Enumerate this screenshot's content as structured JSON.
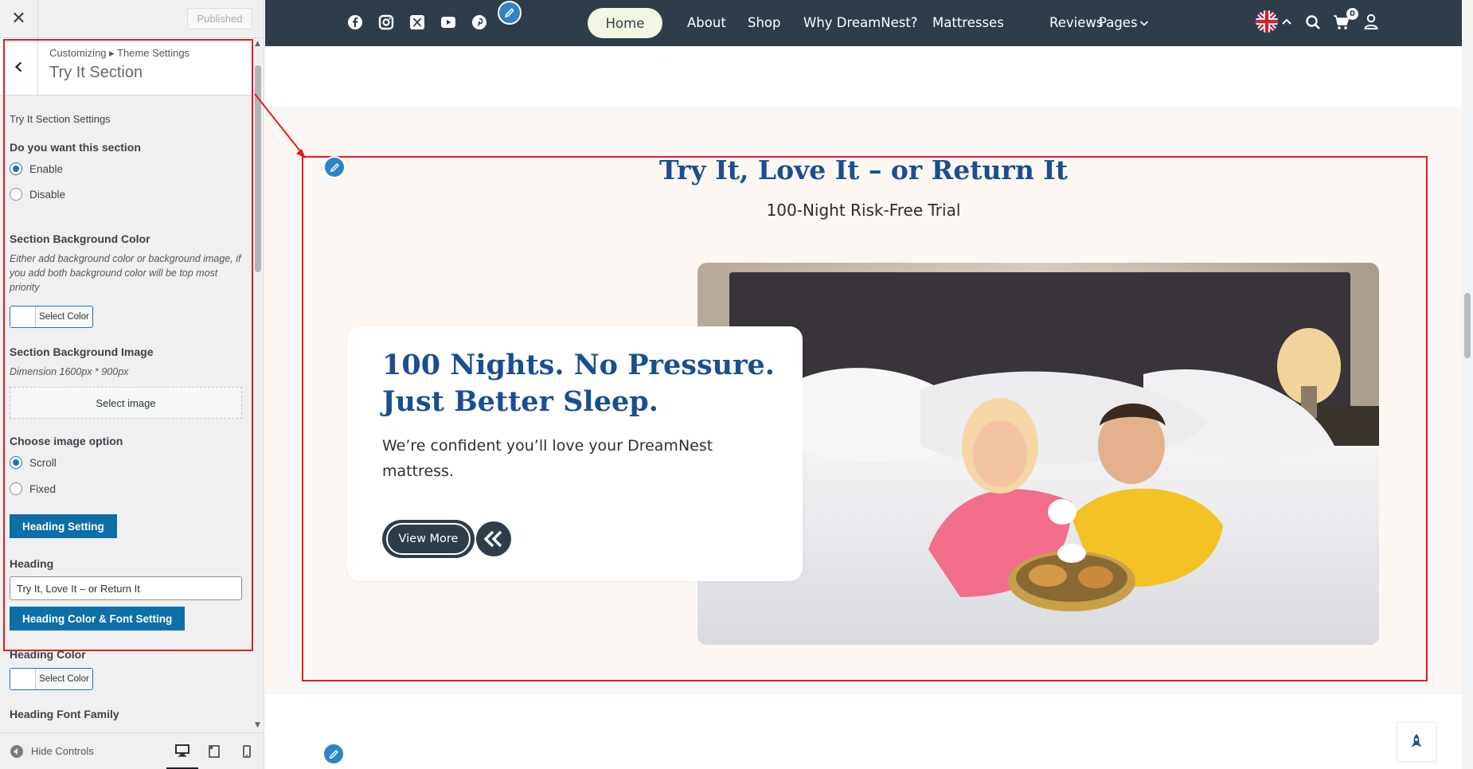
{
  "customizer": {
    "close_icon": "close-icon",
    "published_label": "Published",
    "breadcrumb": "Customizing ▸ Theme Settings",
    "section_title": "Try It Section",
    "settings_heading": "Try It Section Settings",
    "enable_label": "Do you want this section",
    "enable_options": [
      "Enable",
      "Disable"
    ],
    "enable_selected": "Enable",
    "bg_color_label": "Section Background Color",
    "bg_color_desc": "Either add background color or background image, if you add both background color will be top most priority",
    "select_color_label": "Select Color",
    "bg_image_label": "Section Background Image",
    "bg_image_desc": "Dimension 1600px * 900px",
    "select_image_label": "Select image",
    "image_option_label": "Choose image option",
    "image_options": [
      "Scroll",
      "Fixed"
    ],
    "image_option_selected": "Scroll",
    "heading_setting_btn": "Heading Setting",
    "heading_label": "Heading",
    "heading_value": "Try It, Love It – or Return It",
    "heading_font_btn": "Heading Color & Font Setting",
    "heading_color_label": "Heading Color",
    "heading_font_family_label": "Heading Font Family",
    "hide_controls_label": "Hide Controls"
  },
  "preview": {
    "nav": {
      "items": [
        "Home",
        "About",
        "Shop",
        "Why DreamNest?",
        "Mattresses",
        "Reviews",
        "Pages"
      ],
      "active": "Home",
      "cart_count": "0",
      "social_icons": [
        "facebook-icon",
        "instagram-icon",
        "x-icon",
        "youtube-icon",
        "pinterest-icon"
      ]
    },
    "try_section": {
      "heading": "Try It, Love It – or Return It",
      "subheading": "100-Night Risk-Free Trial",
      "card_title": "100 Nights. No Pressure. Just Better Sleep.",
      "card_text": "We’re confident you’ll love your DreamNest mattress.",
      "button_label": "View More"
    }
  },
  "colors": {
    "nav_bg": "#2f3d4b",
    "accent_blue": "#1a4e92",
    "wp_blue": "#0d6fa8",
    "highlight_red": "#e21d24",
    "section_bg": "#fdf7f3"
  }
}
